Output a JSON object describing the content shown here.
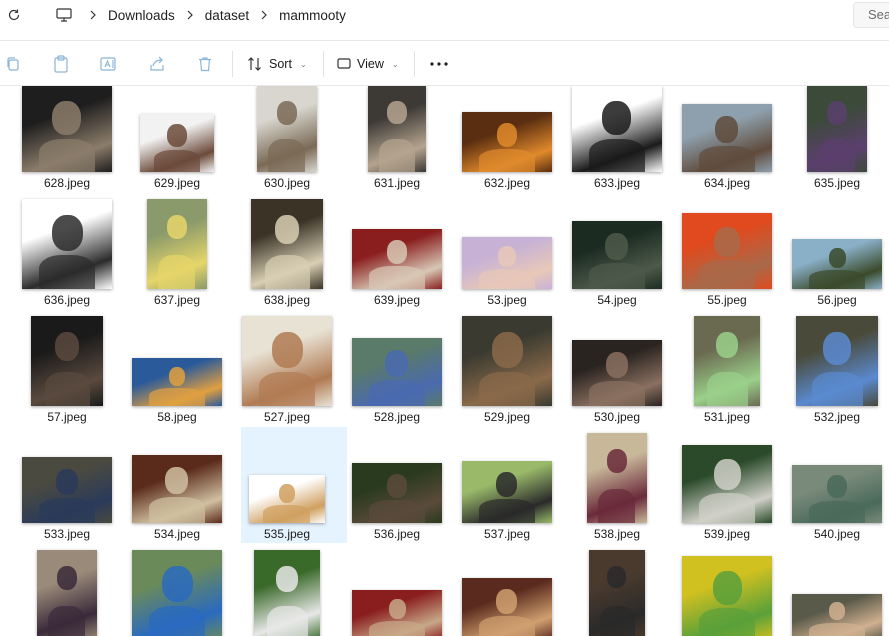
{
  "addressbar": {
    "breadcrumbs": [
      "Downloads",
      "dataset",
      "mammooty"
    ],
    "search_text": "Sea"
  },
  "commandbar": {
    "sort_label": "Sort",
    "view_label": "View"
  },
  "files": [
    {
      "name": "628.jpeg",
      "colors": [
        "#1e1e1e",
        "#8c7d6b"
      ]
    },
    {
      "name": "629.jpeg",
      "colors": [
        "#f2f2f2",
        "#6b4a3a"
      ]
    },
    {
      "name": "630.jpeg",
      "colors": [
        "#d8d6cf",
        "#7a6a55"
      ]
    },
    {
      "name": "631.jpeg",
      "colors": [
        "#3d3a36",
        "#b5a48f"
      ]
    },
    {
      "name": "632.jpeg",
      "colors": [
        "#5a2e10",
        "#e08a2c"
      ]
    },
    {
      "name": "633.jpeg",
      "colors": [
        "#ffffff",
        "#1a1a1a"
      ]
    },
    {
      "name": "634.jpeg",
      "colors": [
        "#8ea0ad",
        "#5f4b3c"
      ]
    },
    {
      "name": "635.jpeg",
      "colors": [
        "#3c4a3a",
        "#5b3f6e"
      ]
    },
    {
      "name": "636.jpeg",
      "colors": [
        "#ffffff",
        "#2b2b2b"
      ]
    },
    {
      "name": "637.jpeg",
      "colors": [
        "#8a9a6a",
        "#e6d56a"
      ]
    },
    {
      "name": "638.jpeg",
      "colors": [
        "#3a3326",
        "#d9cfb4"
      ]
    },
    {
      "name": "639.jpeg",
      "colors": [
        "#8a1e1e",
        "#d8c7b5"
      ]
    },
    {
      "name": "53.jpeg",
      "colors": [
        "#c7b2d6",
        "#e8c8b8"
      ]
    },
    {
      "name": "54.jpeg",
      "colors": [
        "#1c2b22",
        "#4d5a4a"
      ]
    },
    {
      "name": "55.jpeg",
      "colors": [
        "#e04a1e",
        "#a86a4a"
      ]
    },
    {
      "name": "56.jpeg",
      "colors": [
        "#8ab0c8",
        "#3a4a2a"
      ]
    },
    {
      "name": "57.jpeg",
      "colors": [
        "#1a1a1a",
        "#5a4a3e"
      ]
    },
    {
      "name": "58.jpeg",
      "colors": [
        "#2a5a9a",
        "#e0a040"
      ]
    },
    {
      "name": "527.jpeg",
      "colors": [
        "#e8e2d4",
        "#b07a52"
      ]
    },
    {
      "name": "528.jpeg",
      "colors": [
        "#5a7a6a",
        "#4a6ab0"
      ]
    },
    {
      "name": "529.jpeg",
      "colors": [
        "#3a3a30",
        "#8a6a4a"
      ]
    },
    {
      "name": "530.jpeg",
      "colors": [
        "#2a2420",
        "#8a7060"
      ]
    },
    {
      "name": "531.jpeg",
      "colors": [
        "#6a6a50",
        "#9ad08a"
      ]
    },
    {
      "name": "532.jpeg",
      "colors": [
        "#4a4a3a",
        "#5a8ad0"
      ]
    },
    {
      "name": "533.jpeg",
      "colors": [
        "#4a4a40",
        "#2a3a5a"
      ]
    },
    {
      "name": "534.jpeg",
      "colors": [
        "#5a2a1a",
        "#d0c0a0"
      ]
    },
    {
      "name": "535.jpeg",
      "colors": [
        "#ffffff",
        "#d0a060"
      ]
    },
    {
      "name": "536.jpeg",
      "colors": [
        "#2a3a1e",
        "#5a4a3a"
      ]
    },
    {
      "name": "537.jpeg",
      "colors": [
        "#9aba6a",
        "#2a2a2a"
      ]
    },
    {
      "name": "538.jpeg",
      "colors": [
        "#c8b89a",
        "#6a2a3a"
      ]
    },
    {
      "name": "539.jpeg",
      "colors": [
        "#2a4a2a",
        "#d0d0c8"
      ]
    },
    {
      "name": "540.jpeg",
      "colors": [
        "#7a8a7a",
        "#4a6a5a"
      ]
    },
    {
      "name": "",
      "colors": [
        "#9a8a7a",
        "#3a2a3a"
      ]
    },
    {
      "name": "",
      "colors": [
        "#6a8a5a",
        "#2a6ac0"
      ]
    },
    {
      "name": "",
      "colors": [
        "#3a6a2a",
        "#e8e8e8"
      ]
    },
    {
      "name": "",
      "colors": [
        "#8a1e1e",
        "#c8a888"
      ]
    },
    {
      "name": "",
      "colors": [
        "#5a2a1e",
        "#d0a070"
      ]
    },
    {
      "name": "",
      "colors": [
        "#4a3a2e",
        "#2a2a2a"
      ]
    },
    {
      "name": "",
      "colors": [
        "#d0c020",
        "#5aa03a"
      ]
    },
    {
      "name": "",
      "colors": [
        "#5a5a4a",
        "#d0b090"
      ]
    }
  ],
  "accent_colors": {
    "selection": "#cce8ff",
    "hover": "#e5f3ff"
  }
}
